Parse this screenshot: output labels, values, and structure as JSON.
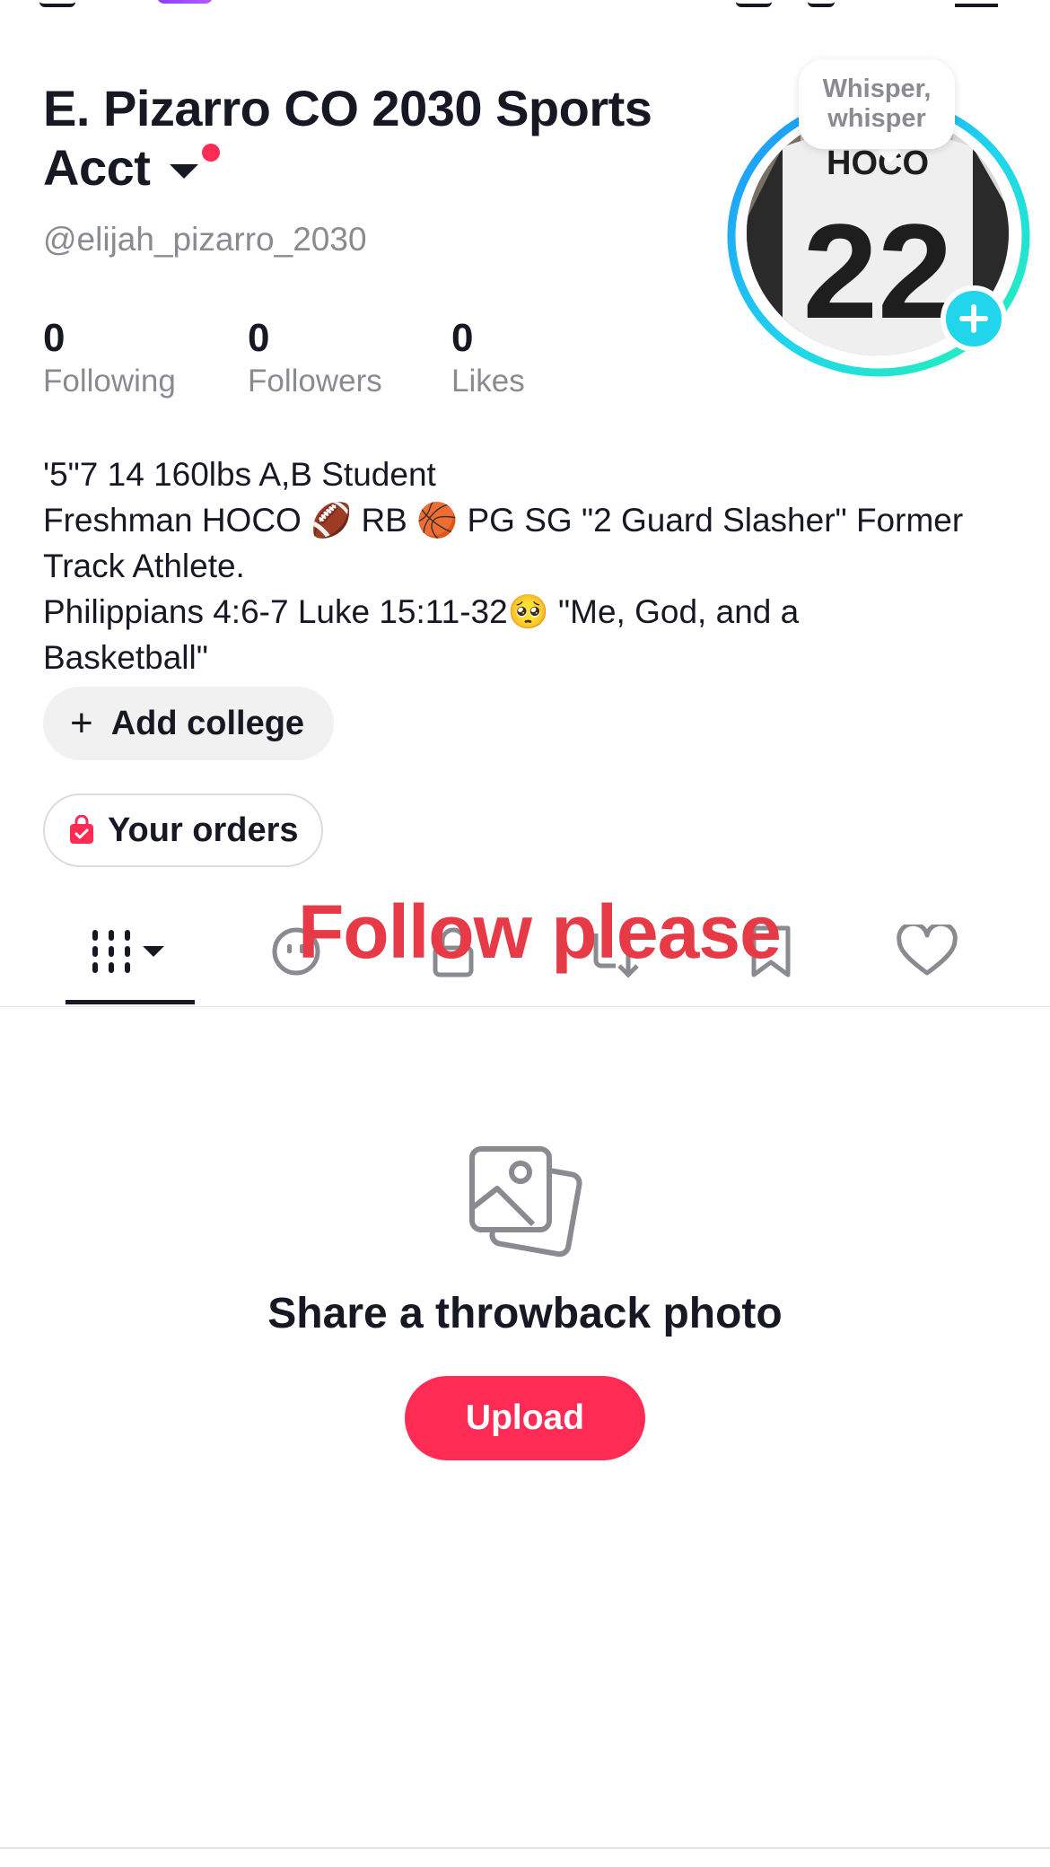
{
  "profile": {
    "display_name": "E. Pizarro CO 2030 Sports Acct",
    "handle": "@elijah_pizarro_2030",
    "avatar_bubble": "Whisper, whisper",
    "stats": [
      {
        "value": "0",
        "label": "Following"
      },
      {
        "value": "0",
        "label": "Followers"
      },
      {
        "value": "0",
        "label": "Likes"
      }
    ],
    "bio_lines": [
      "'5\"7 14 160lbs A,B Student",
      "Freshman HOCO 🏈 RB 🏀 PG SG \"2 Guard Slasher\" Former",
      "Track Athlete.",
      "Philippians 4:6-7 Luke 15:11-32🥺 \"Me, God, and a",
      "Basketball\""
    ]
  },
  "chips": {
    "add_college": "Add college",
    "your_orders": "Your orders"
  },
  "tabs": [
    {
      "name": "videos",
      "icon": "grid-bars-icon",
      "active": true
    },
    {
      "name": "reposts",
      "icon": "repost-face-icon",
      "active": false
    },
    {
      "name": "private",
      "icon": "lock-icon",
      "active": false
    },
    {
      "name": "reposts-saved",
      "icon": "repost-arrows-icon",
      "active": false
    },
    {
      "name": "favorites",
      "icon": "bookmark-icon",
      "active": false
    },
    {
      "name": "liked",
      "icon": "heart-icon",
      "active": false
    }
  ],
  "overlay_text": "Follow please",
  "empty_state": {
    "icon": "photos-icon",
    "title": "Share a throwback photo",
    "button": "Upload"
  },
  "colors": {
    "accent": "#fe2c55",
    "add_button": "#20d5ec",
    "overlay_text": "#e63a46",
    "secondary_text": "#8a8b91"
  }
}
